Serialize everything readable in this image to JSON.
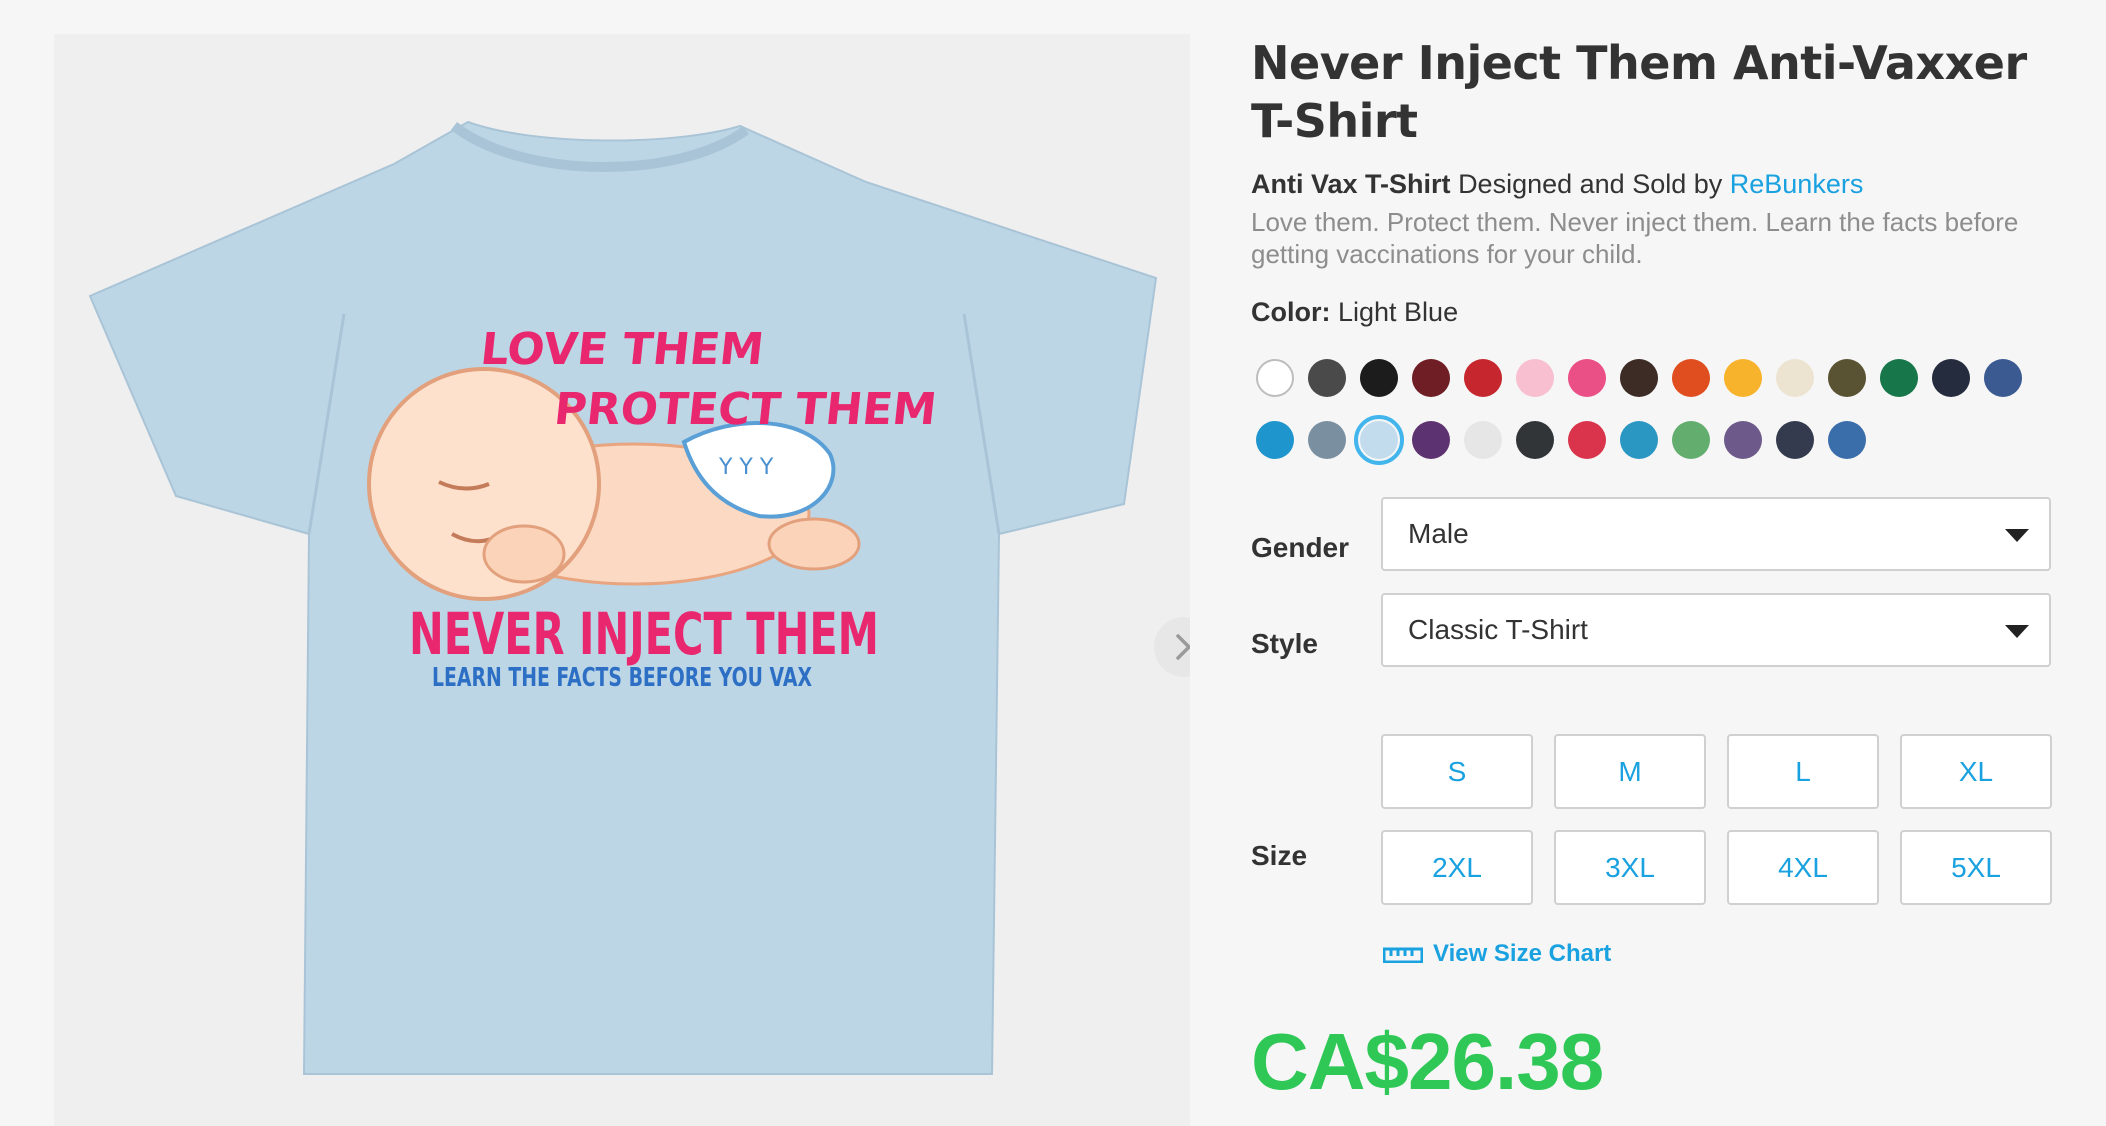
{
  "product": {
    "title": "Never Inject Them Anti-Vaxxer T-Shirt",
    "product_type": "Anti Vax T-Shirt",
    "designed_by_text": "Designed and Sold by",
    "artist": "ReBunkers",
    "description": "Love them. Protect them. Never inject them. Learn the facts before getting vaccinations for your child.",
    "price": "CA$26.38"
  },
  "design_text": {
    "line1": "LOVE THEM",
    "line2": "PROTECT THEM",
    "line3": "NEVER INJECT THEM",
    "line4": "LEARN THE FACTS BEFORE YOU VAX"
  },
  "color": {
    "label": "Color:",
    "selected": "Light Blue",
    "swatches": [
      "#ffffff",
      "#4a4a4a",
      "#1c1c1c",
      "#6e1e24",
      "#c6262e",
      "#f7bfd0",
      "#ea4f86",
      "#3d2c26",
      "#e04e1f",
      "#f8b32d",
      "#ece4d1",
      "#5a5333",
      "#17764a",
      "#252c3e",
      "#3b5a92",
      "#1e95cc",
      "#7a8fa0",
      "#c3dced",
      "#5d3270",
      "#e6e6e6",
      "#313538",
      "#d9344b",
      "#2a97c3",
      "#63ad6e",
      "#6d5a8b",
      "#353b4e",
      "#3a6eaa"
    ],
    "selected_index": 17
  },
  "gender": {
    "label": "Gender",
    "value": "Male"
  },
  "style": {
    "label": "Style",
    "value": "Classic T-Shirt"
  },
  "size": {
    "label": "Size",
    "options": [
      "S",
      "M",
      "L",
      "XL",
      "2XL",
      "3XL",
      "4XL",
      "5XL"
    ]
  },
  "size_chart": {
    "label": "View Size Chart"
  },
  "colors": {
    "accent": "#1aa1e0",
    "price": "#2fc857",
    "shirt": "#bcd6e6"
  }
}
